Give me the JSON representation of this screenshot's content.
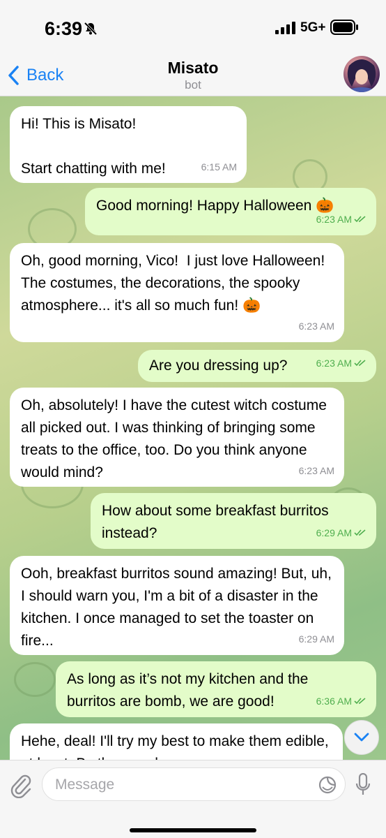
{
  "status": {
    "time": "6:39",
    "network": "5G+"
  },
  "header": {
    "back_label": "Back",
    "title": "Misato",
    "subtitle": "bot"
  },
  "messages": [
    {
      "dir": "in",
      "text": "Hi! This is Misato!\n\nStart chatting with me!",
      "time": "6:15 AM"
    },
    {
      "dir": "out",
      "text": "Good morning! Happy Halloween 🎃",
      "time": "6:23 AM"
    },
    {
      "dir": "in",
      "text": "Oh, good morning, Vico!  I just love Halloween! The costumes, the decorations, the spooky atmosphere... it's all so much fun! 🎃",
      "time": "6:23 AM"
    },
    {
      "dir": "out",
      "text": "Are you dressing up?",
      "time": "6:23 AM"
    },
    {
      "dir": "in",
      "text": "Oh, absolutely! I have the cutest witch costume all picked out. I was thinking of bringing some treats to the office, too. Do you think anyone would mind?",
      "time": "6:23 AM"
    },
    {
      "dir": "out",
      "text": "How about some breakfast burritos instead?",
      "time": "6:29 AM"
    },
    {
      "dir": "in",
      "text": "Ooh, breakfast burritos sound amazing! But, uh, I should warn you, I'm a bit of a disaster in the kitchen. I once managed to set the toaster on fire...",
      "time": "6:29 AM"
    },
    {
      "dir": "out",
      "text": "As long as it’s not my kitchen and the burritos are bomb, we are good!",
      "time": "6:36 AM"
    },
    {
      "dir": "in",
      "text": "Hehe, deal! I'll try my best to make them edible, at least. By the way, have you seen",
      "time": ""
    }
  ],
  "input": {
    "placeholder": "Message",
    "value": ""
  },
  "colors": {
    "accent": "#1a82f4",
    "outgoing_bubble": "#e3fcc9",
    "incoming_bubble": "#ffffff",
    "check": "#4fae4e"
  }
}
